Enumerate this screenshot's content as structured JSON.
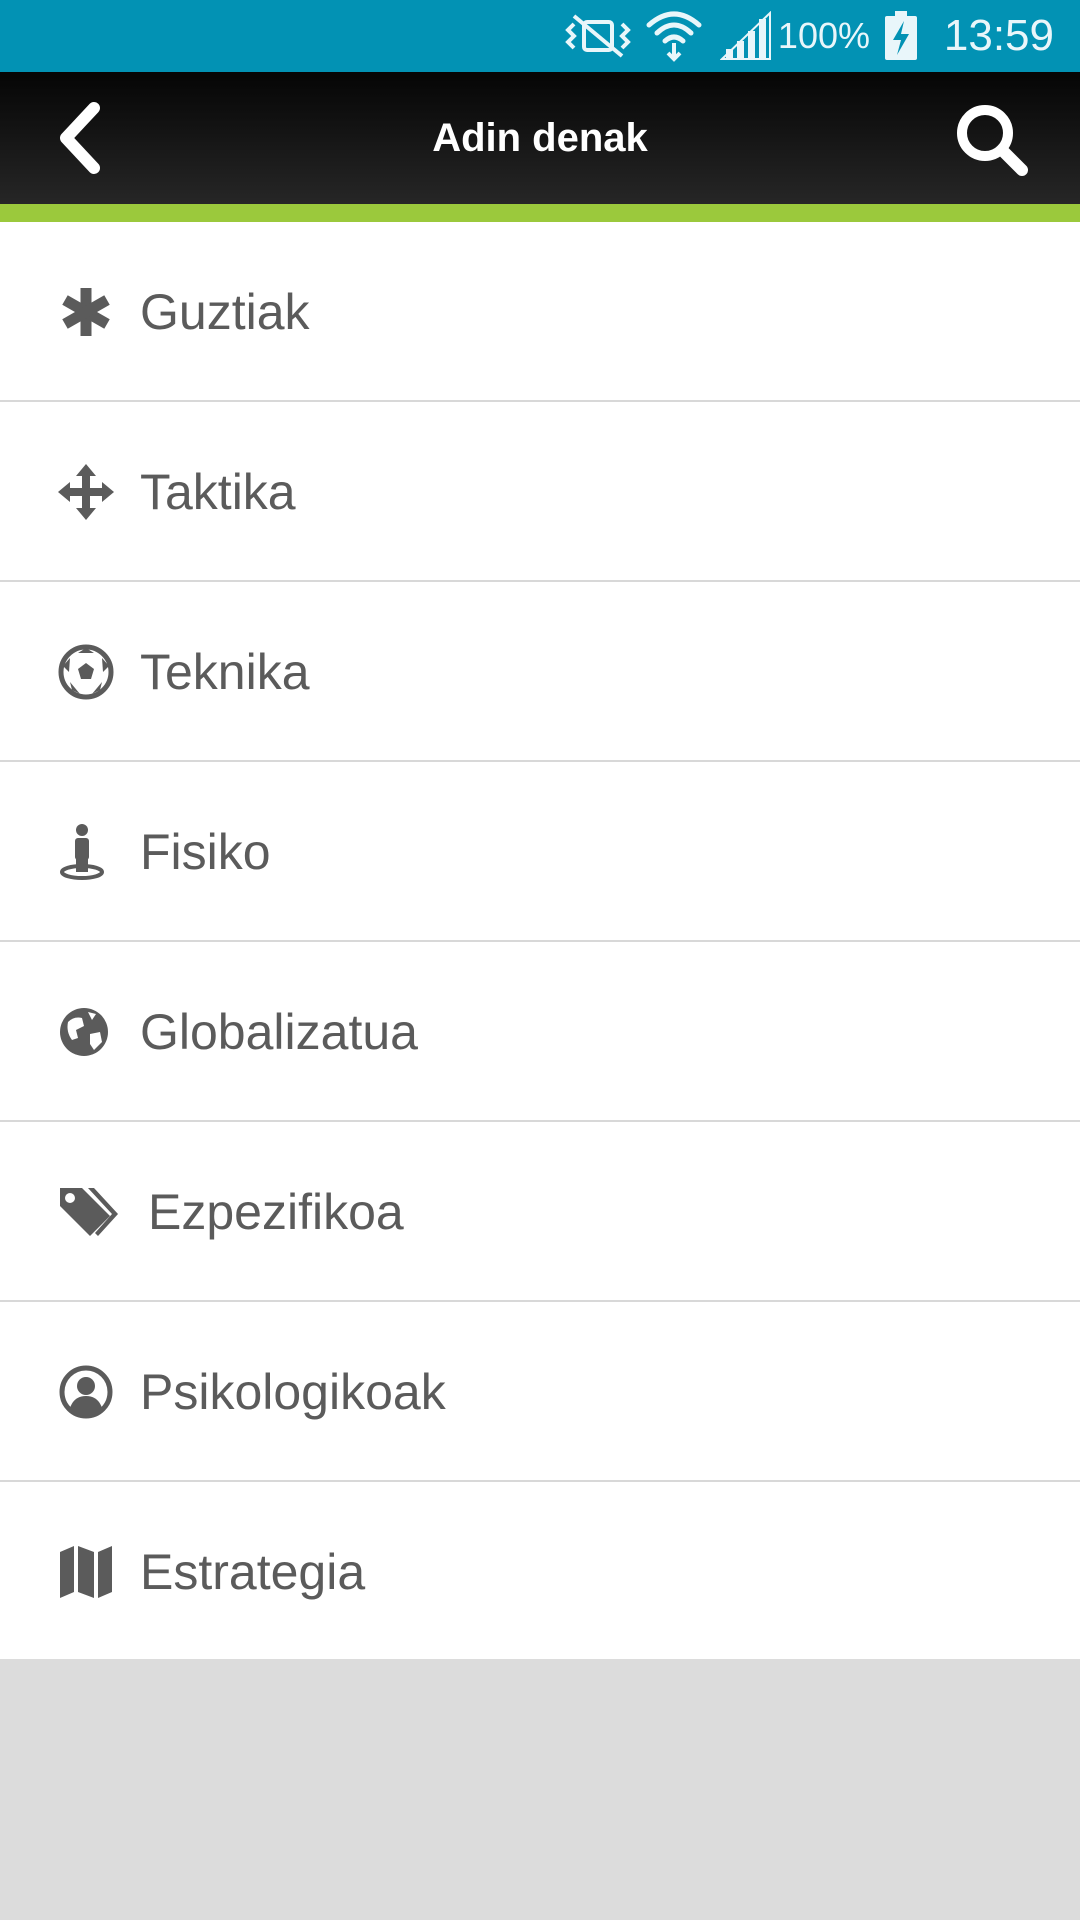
{
  "status_bar": {
    "battery_percent": "100%",
    "time": "13:59"
  },
  "app_bar": {
    "title": "Adin denak"
  },
  "colors": {
    "status_bar": "#0292b4",
    "accent": "#9bc93c",
    "icon": "#5b5b5b"
  },
  "categories": [
    {
      "label": "Guztiak",
      "icon": "asterisk-icon"
    },
    {
      "label": "Taktika",
      "icon": "arrows-move-icon"
    },
    {
      "label": "Teknika",
      "icon": "soccer-ball-icon"
    },
    {
      "label": "Fisiko",
      "icon": "person-standing-icon"
    },
    {
      "label": "Globalizatua",
      "icon": "globe-icon"
    },
    {
      "label": "Ezpezifikoa",
      "icon": "tags-icon"
    },
    {
      "label": "Psikologikoak",
      "icon": "user-circle-icon"
    },
    {
      "label": "Estrategia",
      "icon": "map-icon"
    }
  ]
}
